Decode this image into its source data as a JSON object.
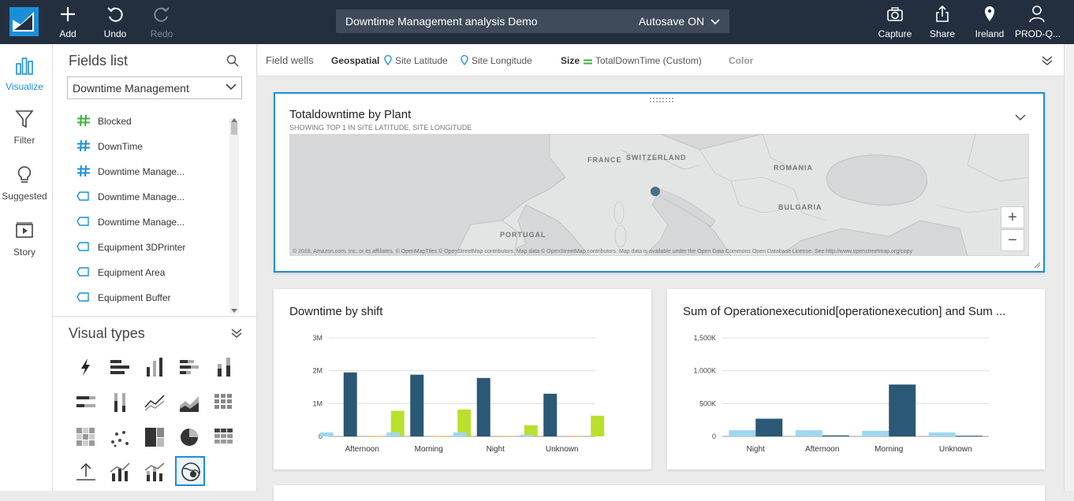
{
  "topbar": {
    "add_label": "Add",
    "undo_label": "Undo",
    "redo_label": "Redo",
    "analysis_title": "Downtime Management analysis Demo",
    "autosave": "Autosave ON",
    "capture_label": "Capture",
    "share_label": "Share",
    "region_label": "Ireland",
    "user_label": "PROD-Q..."
  },
  "leftnav": {
    "visualize": "Visualize",
    "filter": "Filter",
    "suggested": "Suggested",
    "story": "Story"
  },
  "fields": {
    "title": "Fields list",
    "dataset": "Downtime Management",
    "items": [
      {
        "label": "Blocked",
        "type": "measure-green"
      },
      {
        "label": "DownTime",
        "type": "measure"
      },
      {
        "label": "Downtime Manage...",
        "type": "measure"
      },
      {
        "label": "Downtime Manage...",
        "type": "dimension"
      },
      {
        "label": "Downtime Manage...",
        "type": "dimension"
      },
      {
        "label": "Equipment 3DPrinter",
        "type": "dimension"
      },
      {
        "label": "Equipment Area",
        "type": "dimension"
      },
      {
        "label": "Equipment Buffer",
        "type": "dimension"
      }
    ]
  },
  "visual_types": {
    "title": "Visual types"
  },
  "wells": {
    "label": "Field wells",
    "geo_label": "Geospatial",
    "geo_lat": "Site Latitude",
    "geo_lon": "Site Longitude",
    "size_label": "Size",
    "size_value": "TotalDownTime (Custom)",
    "color_label": "Color"
  },
  "map_card": {
    "title": "Totaldowntime by Plant",
    "subtitle": "SHOWING TOP 1 IN SITE LATITUDE, SITE LONGITUDE",
    "labels": {
      "france": "FRANCE",
      "switzerland": "SWITZERLAND",
      "romania": "ROMANIA",
      "bulgaria": "BULGARIA",
      "portugal": "PORTUGAL"
    },
    "attribution": "© 2018, Amazon.com, Inc. or its affiliates. © OpenMapTiles © OpenStreetMap contributors. Map data © OpenStreetMap contributors. Map data is available under the Open Data Commons Open Database License. See http://www.openstreetmap.org/copy",
    "zoom_in": "+",
    "zoom_out": "−"
  },
  "colors": {
    "dark": "#2b5876",
    "light": "#9fd8ee",
    "lime": "#b9e02c",
    "orange": "#e8a33c",
    "accent": "#1a8fd8"
  },
  "chart_data": [
    {
      "type": "bar",
      "title": "Downtime by shift",
      "categories": [
        "Afternoon",
        "Morning",
        "Night",
        "Unknown"
      ],
      "yticks": [
        "0",
        "1M",
        "2M",
        "3M"
      ],
      "ylim": [
        0,
        3000000
      ],
      "series": [
        {
          "values": [
            120000,
            120000,
            120000,
            50000
          ]
        },
        {
          "values": [
            1950000,
            1880000,
            1780000,
            1300000
          ]
        },
        {
          "values": [
            10000,
            10000,
            10000,
            10000
          ]
        },
        {
          "values": [
            780000,
            820000,
            340000,
            630000
          ]
        }
      ]
    },
    {
      "type": "bar",
      "title": "Sum of Operationexecutionid[operationexecution] and Sum ...",
      "categories": [
        "Night",
        "Afternoon",
        "Morning",
        "Unknown"
      ],
      "yticks": [
        "0",
        "500K",
        "1,000K",
        "1,500K"
      ],
      "ylim": [
        0,
        1500000
      ],
      "series": [
        {
          "values": [
            95000,
            95000,
            85000,
            60000
          ]
        },
        {
          "values": [
            270000,
            15000,
            790000,
            10000
          ]
        }
      ]
    }
  ]
}
